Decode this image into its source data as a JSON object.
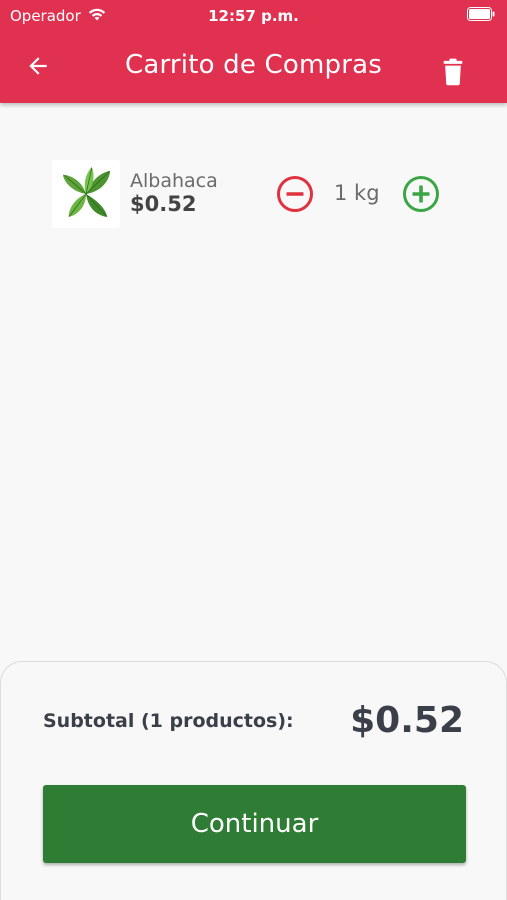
{
  "status_bar": {
    "carrier": "Operador",
    "time": "12:57 p.m."
  },
  "header": {
    "title": "Carrito de Compras",
    "back_icon": "arrow-left-icon",
    "trash_icon": "trash-icon",
    "color": "#e03150"
  },
  "cart": {
    "items": [
      {
        "name": "Albahaca",
        "price": "$0.52",
        "quantity": "1 kg",
        "image_icon": "basil-leaf-icon"
      }
    ]
  },
  "summary": {
    "subtotal_label": "Subtotal (1 productos):",
    "subtotal_value": "$0.52",
    "continue_label": "Continuar",
    "button_color": "#2f7d34"
  }
}
